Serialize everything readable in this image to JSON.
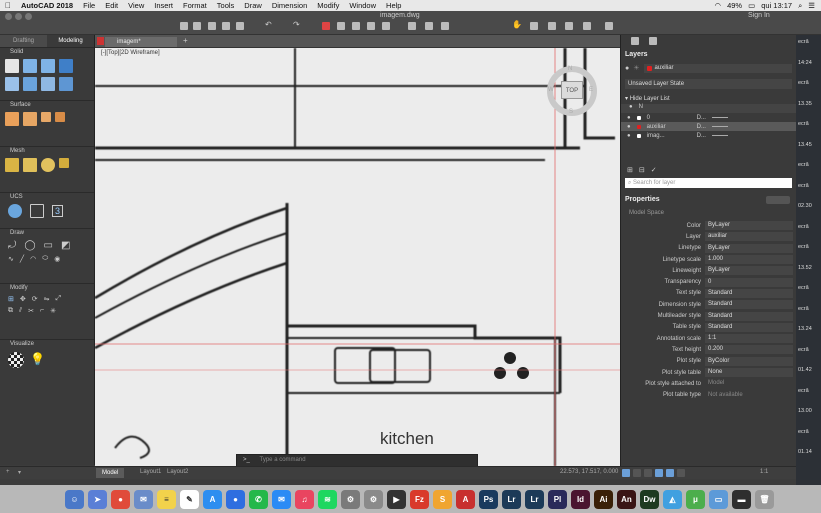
{
  "menubar": {
    "apple": "",
    "app": "AutoCAD 2018",
    "items": [
      "File",
      "Edit",
      "View",
      "Insert",
      "Format",
      "Tools",
      "Draw",
      "Dimension",
      "Modify",
      "Window",
      "Help"
    ],
    "battery": "49%",
    "clock": "qui 13:17"
  },
  "toolbar": {
    "doc_title": "imagem.dwg",
    "signin": "Sign In"
  },
  "doc_tab": {
    "label": "imagem*"
  },
  "left_panel": {
    "tabs": [
      "Drafting",
      "Modeling"
    ],
    "sections": [
      "Solid",
      "Surface",
      "Mesh",
      "UCS",
      "Draw",
      "Modify",
      "Visualize"
    ],
    "ucs_label": "3"
  },
  "viewport": {
    "label": "[-][Top][2D Wireframe]",
    "viewcube": "TOP",
    "compass": {
      "n": "N",
      "s": "S",
      "e": "E",
      "w": "W"
    },
    "drawing_text": "kitchen"
  },
  "command": {
    "placeholder": "Type a command",
    "prompt": ">_"
  },
  "status": {
    "model": "Model",
    "layout1": "Layout1",
    "layout2": "Layout2",
    "coords": "22.573, 17.517, 0.000",
    "scale": "1:1"
  },
  "layers": {
    "title": "Layers",
    "current": "auxiliar",
    "state": "Unsaved Layer State",
    "hide_list": "Hide Layer List",
    "col_name": "N",
    "rows": [
      {
        "name": "0",
        "desc": "D..."
      },
      {
        "name": "auxiliar",
        "desc": "D..."
      },
      {
        "name": "imag...",
        "desc": "D..."
      }
    ],
    "search": "Search for layer"
  },
  "properties": {
    "title": "Properties",
    "subtitle": "Model Space",
    "rows": [
      {
        "k": "Color",
        "v": "ByLayer"
      },
      {
        "k": "Layer",
        "v": "auxiliar"
      },
      {
        "k": "Linetype",
        "v": "ByLayer"
      },
      {
        "k": "Linetype scale",
        "v": "1.000"
      },
      {
        "k": "Lineweight",
        "v": "ByLayer"
      },
      {
        "k": "Transparency",
        "v": "0"
      },
      {
        "k": "Text style",
        "v": "Standard"
      },
      {
        "k": "Dimension style",
        "v": "Standard"
      },
      {
        "k": "Multileader style",
        "v": "Standard"
      },
      {
        "k": "Table style",
        "v": "Standard"
      },
      {
        "k": "Annotation scale",
        "v": "1:1"
      },
      {
        "k": "Text height",
        "v": "0.200"
      },
      {
        "k": "Plot style",
        "v": "ByColor"
      },
      {
        "k": "Plot style table",
        "v": "None"
      },
      {
        "k": "Plot style attached to",
        "v": "Model"
      },
      {
        "k": "Plot table type",
        "v": "Not available"
      }
    ]
  },
  "edge_notes": [
    "ecrã",
    "14:24",
    "ecrã",
    "13.35",
    "ecrã",
    "13.45",
    "ecrã",
    "ecrã",
    "02.30",
    "ecrã",
    "ecrã",
    "13.52",
    "ecrã",
    "ecrã",
    "13.24",
    "ecrã",
    "01.42",
    "ecrã",
    "13.00",
    "ecrã",
    "01.14"
  ],
  "dock": [
    {
      "label": "☺",
      "color": "#4a78c8"
    },
    {
      "label": "➤",
      "color": "#5a7fd6"
    },
    {
      "label": "●",
      "color": "#e04b3a"
    },
    {
      "label": "✉",
      "color": "#6a8cc9"
    },
    {
      "label": "≡",
      "color": "#f2d24b"
    },
    {
      "label": "✎",
      "color": "#ffffff"
    },
    {
      "label": "A",
      "color": "#2d8ef0"
    },
    {
      "label": "●",
      "color": "#2e6ee0"
    },
    {
      "label": "✆",
      "color": "#25b84a"
    },
    {
      "label": "✉",
      "color": "#2b8bf5"
    },
    {
      "label": "♫",
      "color": "#e94560"
    },
    {
      "label": "≋",
      "color": "#1ed760"
    },
    {
      "label": "⚙",
      "color": "#7a7a7a"
    },
    {
      "label": "⚙",
      "color": "#8a8a8a"
    },
    {
      "label": "▶",
      "color": "#333333"
    },
    {
      "label": "Fz",
      "color": "#d93a2b"
    },
    {
      "label": "S",
      "color": "#f0a530"
    },
    {
      "label": "A",
      "color": "#c8302e"
    },
    {
      "label": "Ps",
      "color": "#1a3a5e"
    },
    {
      "label": "Lr",
      "color": "#1c3a58"
    },
    {
      "label": "Lr",
      "color": "#1c3a58"
    },
    {
      "label": "Pl",
      "color": "#2a2a5a"
    },
    {
      "label": "Id",
      "color": "#4b1530"
    },
    {
      "label": "Ai",
      "color": "#3a2008"
    },
    {
      "label": "An",
      "color": "#3a1515"
    },
    {
      "label": "Dw",
      "color": "#1e3a20"
    },
    {
      "label": "◭",
      "color": "#40a0e0"
    },
    {
      "label": "μ",
      "color": "#4cae4c"
    },
    {
      "label": "▭",
      "color": "#5c9ad8"
    },
    {
      "label": "▬",
      "color": "#2e2e2e"
    },
    {
      "label": "🗑",
      "color": "#9a9a9a"
    }
  ]
}
